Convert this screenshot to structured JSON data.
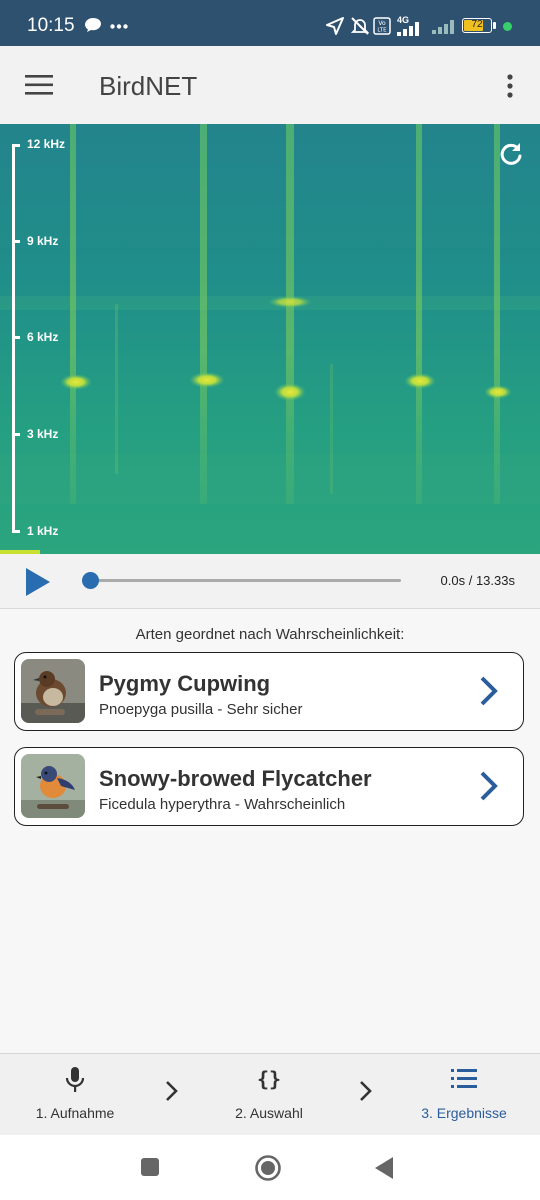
{
  "status_bar": {
    "time": "10:15",
    "icons": [
      "chat-bubble-icon",
      "more-dots-icon",
      "location-arrow-icon",
      "mute-bell-icon",
      "volte-icon",
      "signal-4g-icon",
      "signal-icon",
      "battery-icon",
      "dot-icon"
    ],
    "network_label": "4G",
    "battery_level": "72"
  },
  "app_bar": {
    "title": "BirdNET",
    "menu_icon": "hamburger-menu-icon",
    "overflow_icon": "more-vert-icon"
  },
  "spectrogram": {
    "axis_labels": [
      "12 kHz",
      "9 kHz",
      "6 kHz",
      "3 kHz",
      "1 kHz"
    ],
    "refresh_icon": "refresh-icon"
  },
  "player": {
    "play_icon": "play-icon",
    "time": "0.0s / 13.33s",
    "progress": 0
  },
  "results": {
    "heading": "Arten geordnet nach Wahrscheinlichkeit:",
    "items": [
      {
        "common_name": "Pygmy Cupwing",
        "detail": "Pnoepyga pusilla - Sehr sicher"
      },
      {
        "common_name": "Snowy-browed Flycatcher",
        "detail": "Ficedula hyperythra - Wahrscheinlich"
      }
    ]
  },
  "bottom_nav": {
    "items": [
      {
        "label": "1. Aufnahme",
        "icon": "microphone-icon"
      },
      {
        "label": "2. Auswahl",
        "icon": "curly-braces-icon"
      },
      {
        "label": "3. Ergebnisse",
        "icon": "list-icon"
      }
    ],
    "active_index": 2,
    "colors": {
      "active": "#2a5d9c",
      "inactive": "#333333"
    }
  },
  "system_nav": {
    "icons": [
      "recent-apps-icon",
      "home-icon",
      "back-icon"
    ]
  },
  "colors": {
    "status_bar": "#2f5170",
    "accent": "#2a5d9c"
  }
}
